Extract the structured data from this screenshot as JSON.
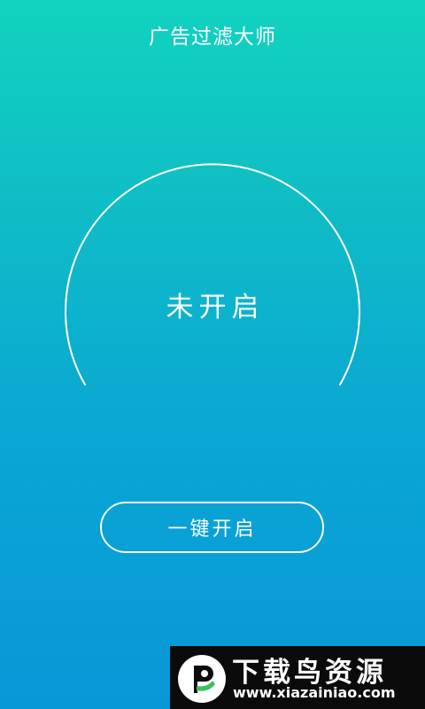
{
  "header": {
    "title": "广告过滤大师"
  },
  "status": {
    "text": "未开启"
  },
  "actions": {
    "enable_label": "一键开启"
  },
  "watermark": {
    "name": "下载鸟资源",
    "url": "www.xiazainiao.com"
  },
  "colors": {
    "gradient_top": "#11d3bf",
    "gradient_bottom": "#0898d8",
    "text": "#ffffff",
    "watermark_bg": "#0b0b0b",
    "logo_green": "#3fbf5a"
  }
}
